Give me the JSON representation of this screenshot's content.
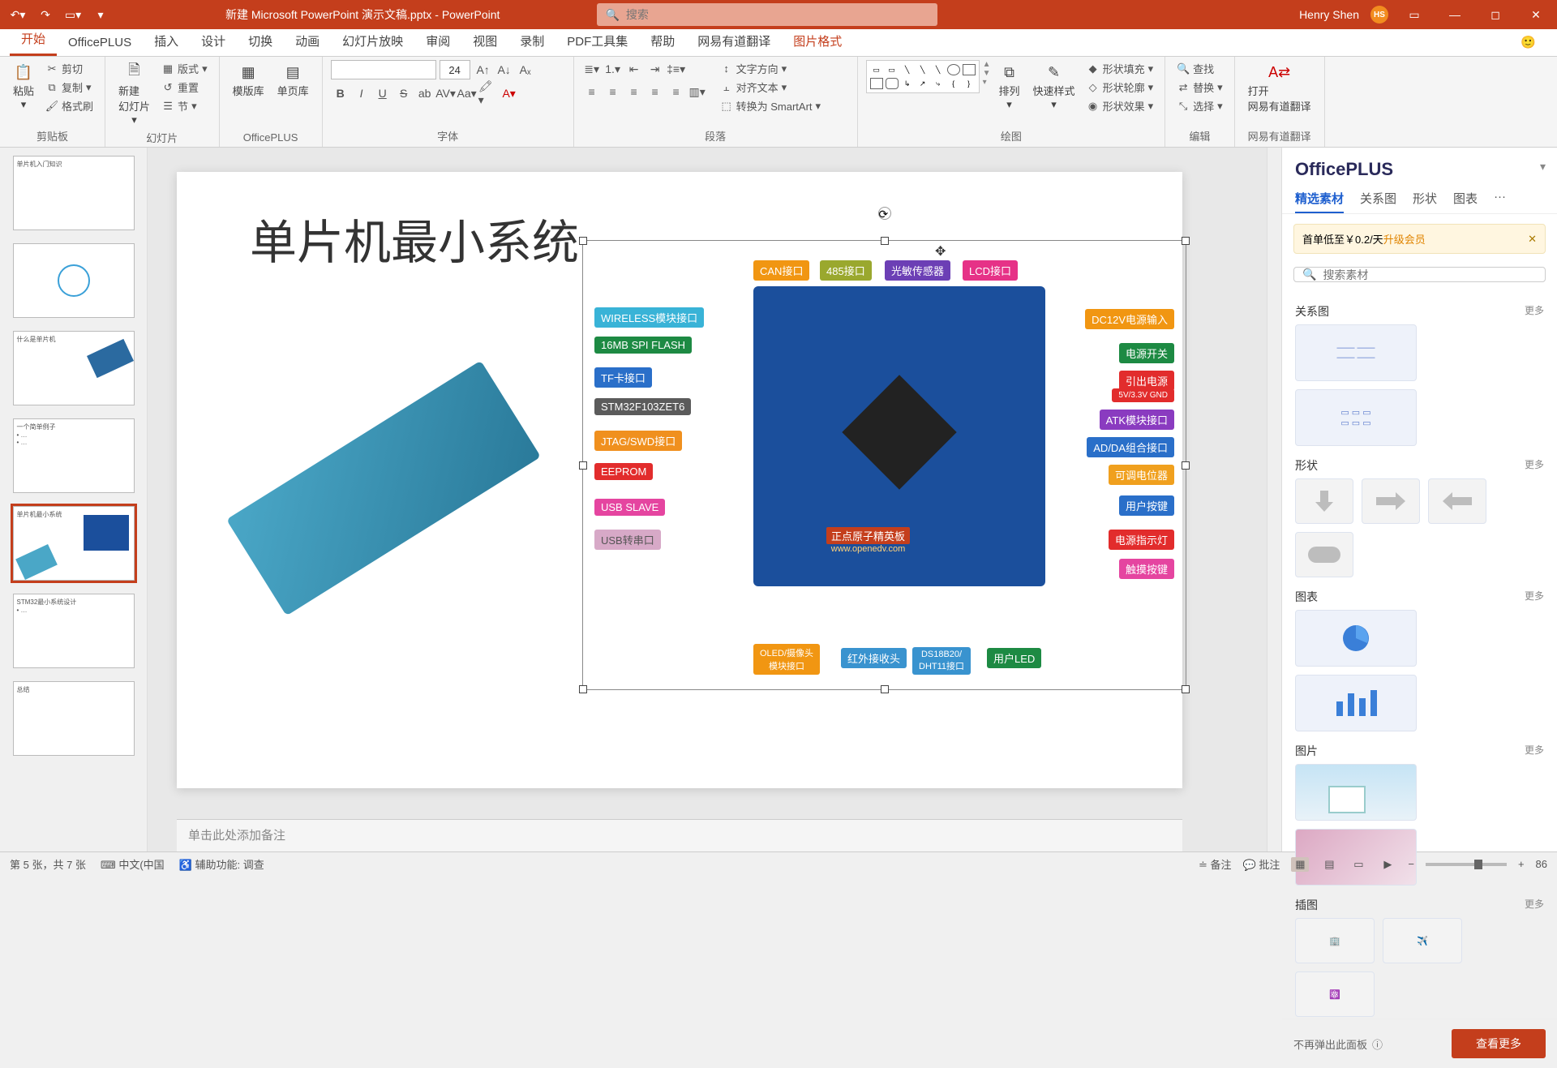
{
  "titlebar": {
    "filename": "新建 Microsoft PowerPoint 演示文稿.pptx - PowerPoint",
    "search_placeholder": "搜索",
    "user": "Henry Shen",
    "avatar_initials": "HS"
  },
  "tabs": {
    "start": "开始",
    "officeplus": "OfficePLUS",
    "insert": "插入",
    "design": "设计",
    "transition": "切换",
    "animation": "动画",
    "slideshow": "幻灯片放映",
    "review": "审阅",
    "view": "视图",
    "record": "录制",
    "pdftool": "PDF工具集",
    "help": "帮助",
    "youdao": "网易有道翻译",
    "picfmt": "图片格式"
  },
  "ribbon": {
    "clipboard": {
      "paste": "粘贴",
      "cut": "剪切",
      "copy": "复制",
      "fmtpaint": "格式刷",
      "label": "剪贴板"
    },
    "slides": {
      "new": "新建\n幻灯片",
      "layout": "版式",
      "reset": "重置",
      "section": "节",
      "label": "幻灯片"
    },
    "officeplus": {
      "template": "模版库",
      "single": "单页库",
      "label": "OfficePLUS"
    },
    "font": {
      "size": "24",
      "label": "字体"
    },
    "paragraph": {
      "textdir": "文字方向",
      "align": "对齐文本",
      "smartart": "转换为 SmartArt",
      "label": "段落"
    },
    "drawing": {
      "arrange": "排列",
      "quickstyle": "快速样式",
      "fill": "形状填充",
      "outline": "形状轮廓",
      "effects": "形状效果",
      "label": "绘图"
    },
    "editing": {
      "find": "查找",
      "replace": "替换",
      "select": "选择",
      "label": "编辑"
    },
    "translate": {
      "open": "打开\n网易有道翻译",
      "label": "网易有道翻译"
    }
  },
  "slide": {
    "title": "单片机最小系统",
    "labels_left": [
      "WIRELESS模块接口",
      "16MB SPI FLASH",
      "TF卡接口",
      "STM32F103ZET6",
      "JTAG/SWD接口",
      "EEPROM",
      "USB SLAVE",
      "USB转串口"
    ],
    "labels_top": [
      "CAN接口",
      "485接口",
      "光敏传感器",
      "LCD接口"
    ],
    "labels_right": [
      "DC12V电源输入",
      "电源开关",
      "引出电源",
      "5V/3.3V GND",
      "ATK模块接口",
      "AD/DA组合接口",
      "可调电位器",
      "用户按键",
      "电源指示灯",
      "触摸按键"
    ],
    "labels_bottom": [
      "OLED/摄像头\n模块接口",
      "红外接收头",
      "DS18B20/\nDHT11接口",
      "用户LED"
    ],
    "brand_line1": "正点原子精英板",
    "brand_line2": "www.openedv.com",
    "notes_placeholder": "单击此处添加备注"
  },
  "sidepanel": {
    "title": "OfficePLUS",
    "tabs": {
      "featured": "精选素材",
      "diagram": "关系图",
      "shape": "形状",
      "chart": "图表",
      "more": "···"
    },
    "promo_prefix": "首单低至￥0.2/天",
    "promo_upgrade": "升级会员",
    "search_placeholder": "搜索素材",
    "cat_diagram": "关系图",
    "cat_shape": "形状",
    "cat_chart": "图表",
    "cat_image": "图片",
    "cat_illustration": "插图",
    "more": "更多",
    "dont_show": "不再弹出此面板",
    "see_more": "查看更多"
  },
  "status": {
    "slide_counter": "第 5 张，共 7 张",
    "lang": "中文(中国",
    "access": "辅助功能: 调查",
    "notes_btn": "备注",
    "comments_btn": "批注",
    "zoom": "86"
  }
}
